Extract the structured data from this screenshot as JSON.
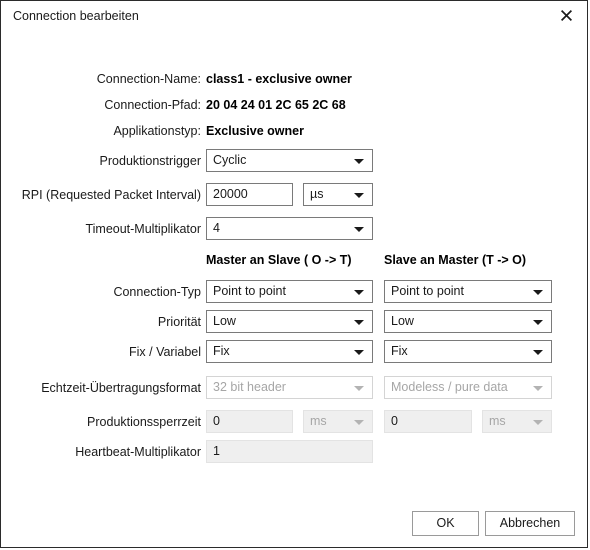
{
  "window": {
    "title": "Connection bearbeiten",
    "close_icon": "close-icon"
  },
  "info": [
    {
      "label": "Connection-Name:",
      "value": "class1 - exclusive owner"
    },
    {
      "label": "Connection-Pfad:",
      "value": "20 04 24 01 2C 65 2C 68"
    },
    {
      "label": "Applikationstyp:",
      "value": "Exclusive owner"
    }
  ],
  "general": {
    "trigger": {
      "label": "Produktionstrigger",
      "value": "Cyclic"
    },
    "rpi": {
      "label": "RPI (Requested Packet Interval)",
      "value": "20000",
      "unit": "µs"
    },
    "timeout": {
      "label": "Timeout-Multiplikator",
      "value": "4"
    }
  },
  "columns": {
    "master_to_slave": "Master an Slave ( O -> T)",
    "slave_to_master": "Slave an Master (T -> O)"
  },
  "pairs": [
    {
      "label": "Connection-Typ",
      "left": "Point to point",
      "right": "Point to point"
    },
    {
      "label": "Priorität",
      "left": "Low",
      "right": "Low"
    },
    {
      "label": "Fix / Variabel",
      "left": "Fix",
      "right": "Fix"
    },
    {
      "label": "Echtzeit-Übertragungsformat",
      "left": "32 bit header",
      "right": "Modeless / pure data"
    }
  ],
  "inhibit": {
    "label": "Produktionssperrzeit",
    "left_value": "0",
    "left_unit": "ms",
    "right_value": "0",
    "right_unit": "ms"
  },
  "heartbeat": {
    "label": "Heartbeat-Multiplikator",
    "value": "1"
  },
  "buttons": {
    "ok": "OK",
    "cancel": "Abbrechen"
  },
  "colors": {
    "window_border": "#2b2b2b",
    "control_border": "#7a7a7a",
    "disabled_text": "#a6a6a6",
    "filled_bg": "#efefef",
    "text": "#1a1a1a"
  }
}
